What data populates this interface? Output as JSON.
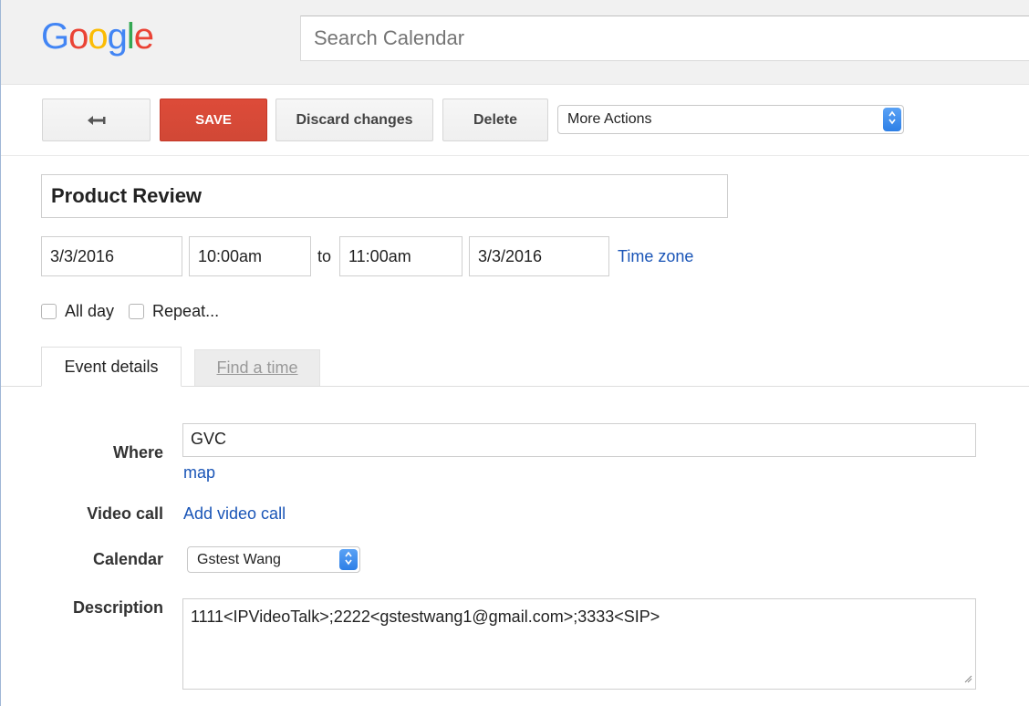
{
  "header": {
    "logo_letters": [
      "G",
      "o",
      "o",
      "g",
      "l",
      "e"
    ],
    "search_placeholder": "Search Calendar"
  },
  "toolbar": {
    "back_icon": "←",
    "save_label": "SAVE",
    "discard_label": "Discard changes",
    "delete_label": "Delete",
    "more_actions_value": "More Actions"
  },
  "event": {
    "title": "Product Review",
    "start_date": "3/3/2016",
    "start_time": "10:00am",
    "to_label": "to",
    "end_time": "11:00am",
    "end_date": "3/3/2016",
    "time_zone_link": "Time zone",
    "all_day_label": "All day",
    "repeat_label": "Repeat..."
  },
  "tabs": {
    "event_details": "Event details",
    "find_a_time": "Find a time"
  },
  "details": {
    "where_label": "Where",
    "where_value": "GVC",
    "map_link": "map",
    "video_call_label": "Video call",
    "add_video_call_link": "Add video call",
    "calendar_label": "Calendar",
    "calendar_value": "Gstest Wang",
    "description_label": "Description",
    "description_value": "1111<IPVideoTalk>;2222<gstestwang1@gmail.com>;3333<SIP>"
  },
  "colors": {
    "save_red": "#d14836",
    "link_blue": "#1a55b7",
    "select_arrow_blue": "#2d7fe6"
  },
  "icons": {
    "back": "back-arrow-icon",
    "select_arrows": "updown-chevron-icon",
    "resize": "resize-grip-icon"
  }
}
